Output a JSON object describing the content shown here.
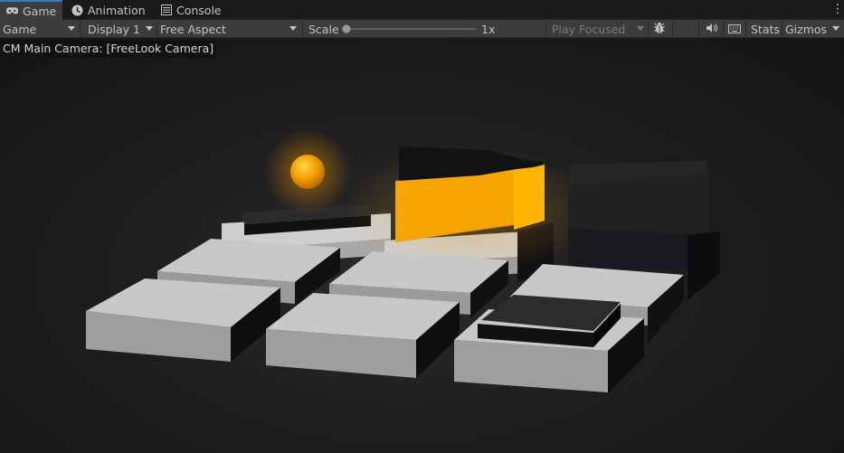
{
  "tabs": [
    {
      "label": "Game",
      "icon": "gamepad-icon",
      "active": true
    },
    {
      "label": "Animation",
      "icon": "animation-icon",
      "active": false
    },
    {
      "label": "Console",
      "icon": "console-icon",
      "active": false
    }
  ],
  "toolbar": {
    "view_mode": "Game",
    "display": "Display 1",
    "aspect": "Free Aspect",
    "scale_label": "Scale",
    "scale_value": "1x",
    "scale_fraction": 0.0,
    "play_mode": "Play Focused",
    "stats_label": "Stats",
    "gizmos_label": "Gizmos"
  },
  "viewport": {
    "camera_label": "CM Main Camera: [FreeLook Camera]"
  },
  "colors": {
    "accent_tab": "#3a79bb",
    "glow_orange": "#f0a000",
    "toolbar_bg": "#3c3c3c"
  }
}
